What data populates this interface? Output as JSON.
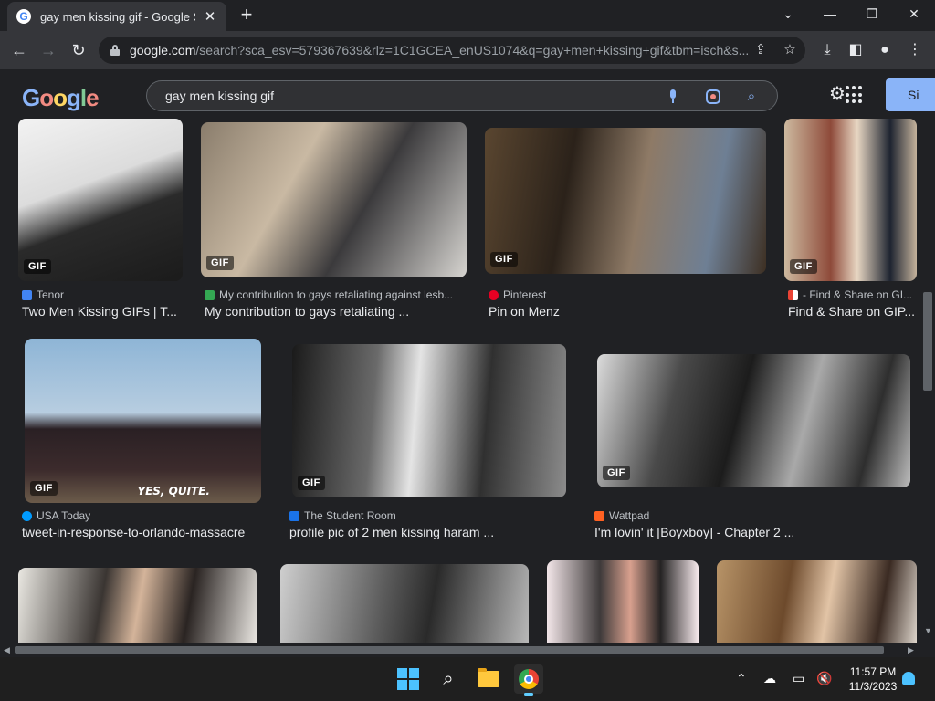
{
  "browser": {
    "tab_title": "gay men kissing gif - Google Se",
    "new_tab": "+",
    "url_host": "google.com",
    "url_rest": "/search?sca_esv=579367639&rlz=1C1GCEA_enUS1074&q=gay+men+kissing+gif&tbm=isch&s...",
    "minimize": "—",
    "maximize": "❐",
    "close": "✕",
    "chevron": "⌄"
  },
  "google": {
    "logo": [
      "G",
      "o",
      "o",
      "g",
      "l",
      "e"
    ],
    "query": "gay men kissing gif",
    "signin_label": "Si"
  },
  "results": [
    {
      "source": "Tenor",
      "title": "Two Men Kissing GIFs | T...",
      "badge": "GIF",
      "source_color": "#4285f4"
    },
    {
      "source": "My contribution to gays retaliating against lesb...",
      "title": "My contribution to gays retaliating ...",
      "badge": "GIF",
      "source_color": "#34a853"
    },
    {
      "source": "Pinterest",
      "title": "Pin on Menz",
      "badge": "GIF",
      "source_color": "#e60023"
    },
    {
      "source": "- Find & Share on GI...",
      "title": "Find & Share on GIP...",
      "badge": "GIF",
      "source_color": "#ea4335"
    },
    {
      "source": "USA Today",
      "title": "tweet-in-response-to-orlando-massacre",
      "badge": "GIF",
      "source_color": "#009bff",
      "caption": "YES, QUITE."
    },
    {
      "source": "The Student Room",
      "title": "profile pic of 2 men kissing haram ...",
      "badge": "GIF",
      "source_color": "#1a73e8"
    },
    {
      "source": "Wattpad",
      "title": "I'm lovin' it [Boyxboy] - Chapter 2 ...",
      "badge": "GIF",
      "source_color": "#ff6122"
    }
  ],
  "taskbar": {
    "time": "11:57 PM",
    "date": "11/3/2023"
  }
}
